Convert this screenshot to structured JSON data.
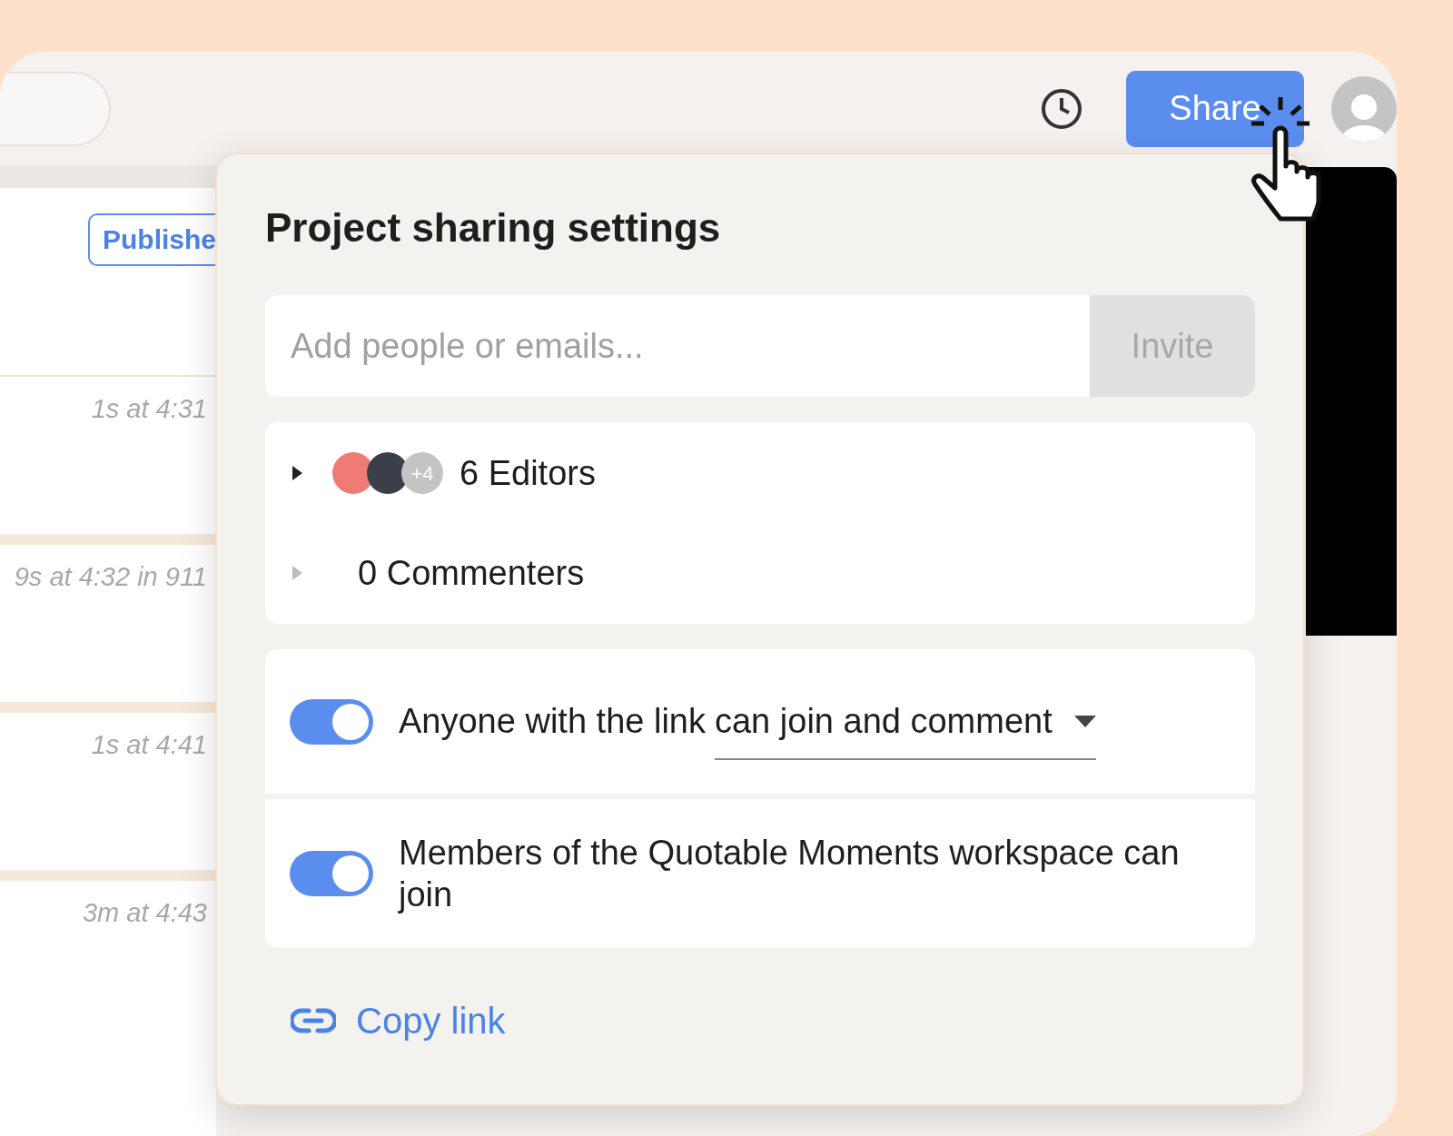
{
  "top_bar": {
    "share_button": "Share"
  },
  "list": {
    "status_badge": "Publishe",
    "rows": [
      {
        "time": "1s at 4:31"
      },
      {
        "time": "9s at 4:32 in 911"
      },
      {
        "time": "1s at 4:41"
      },
      {
        "time": "3m at 4:43"
      }
    ]
  },
  "dialog": {
    "title": "Project sharing settings",
    "invite": {
      "placeholder": "Add people or emails...",
      "button": "Invite"
    },
    "groups": [
      {
        "label": "6 Editors",
        "expanded": false,
        "disabled": false,
        "avatars": [
          {
            "kind": "photo",
            "color": "#ef7b74"
          },
          {
            "kind": "photo",
            "color": "#3a3f4a"
          },
          {
            "kind": "count",
            "color": "#c4c4c4",
            "text": "+4"
          }
        ]
      },
      {
        "label": "0 Commenters",
        "expanded": false,
        "disabled": true
      }
    ],
    "toggles": [
      {
        "kind": "select",
        "label": "Anyone with the link",
        "value": "can join and comment",
        "on": true
      },
      {
        "kind": "plain",
        "label": "Members of the Quotable Moments workspace can join",
        "on": true
      }
    ],
    "copy_link": "Copy link"
  }
}
